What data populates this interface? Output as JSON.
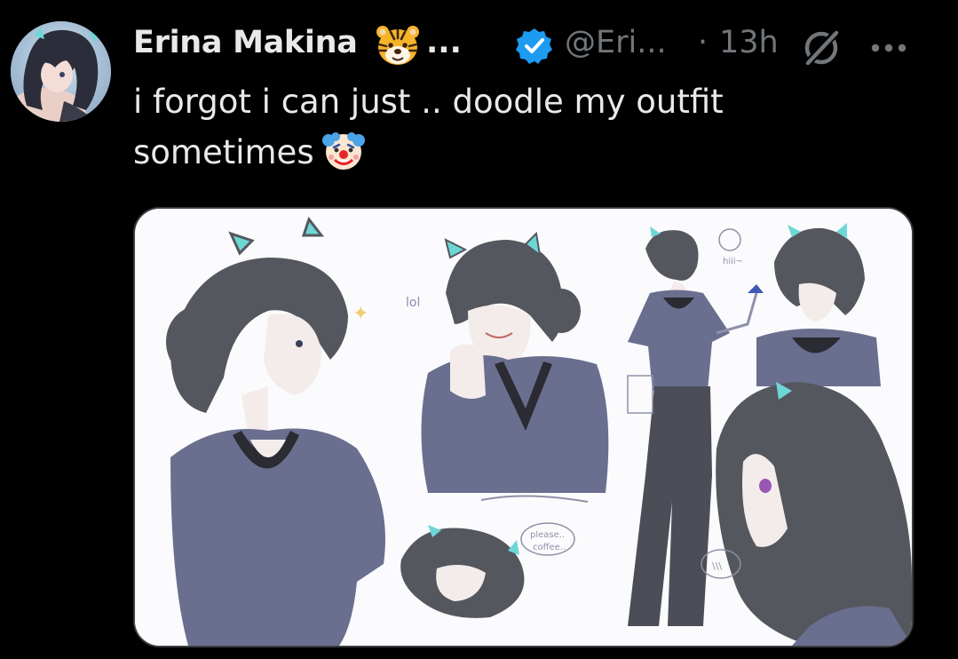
{
  "tweet": {
    "display_name": "Erina Makina",
    "name_emoji": "tiger-face-emoji",
    "name_truncation": "...",
    "handle": "@Eri...",
    "separator": "·",
    "timestamp": "13h",
    "text_line1": "i forgot i can just .. doodle my outfit",
    "text_line2": "sometimes",
    "text_emoji": "clown-face-emoji"
  },
  "media": {
    "doodles": {
      "lol": "lol",
      "hiii": "hiii~",
      "please": "please..",
      "coffee": "coffee..",
      "bubble_bottom": "\\\\\\"
    }
  },
  "colors": {
    "background": "#000000",
    "text_primary": "#e7e9ea",
    "text_secondary": "#71767b",
    "verified_blue": "#1d9bf0",
    "shirt": "#6a6f8f",
    "hair": "#55575e",
    "ears": "#6fd6d6"
  }
}
